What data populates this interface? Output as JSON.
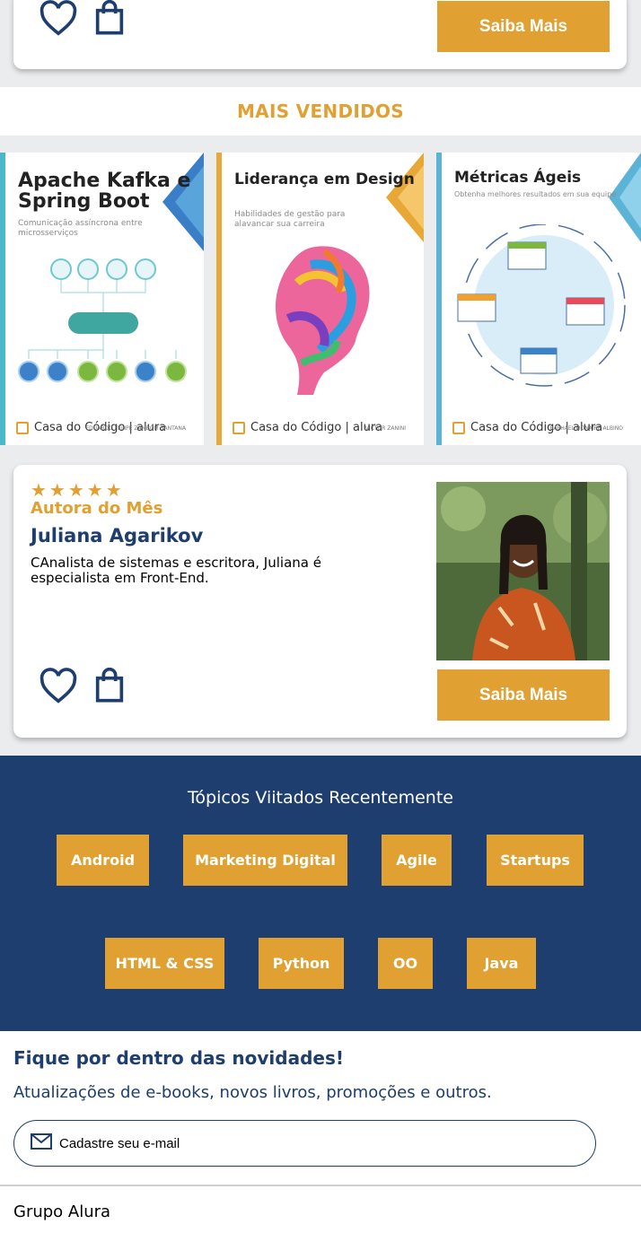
{
  "top_card": {
    "saiba_label": "Saiba Mais"
  },
  "best_sellers": {
    "title": "MAIS VENDIDOS",
    "books": [
      {
        "title": "Apache Kafka e Spring Boot",
        "subtitle": "Comunicação assíncrona entre microsserviços",
        "publisher": "Casa do Código | alura",
        "author": "EDUARDO FELIPE ZAMBOM SANTANA",
        "color": "#4bb8c8"
      },
      {
        "title": "Liderança em Design",
        "subtitle": "Habilidades de gestão para alavancar sua carreira",
        "publisher": "Casa do Código | alura",
        "author": "VICTOR ZANINI",
        "color": "#e8a93a"
      },
      {
        "title": "Métricas Ágeis",
        "subtitle": "Obtenha melhores resultados em sua equipe",
        "publisher": "Casa do Código | alura",
        "author": "RAPHAEL DONAIRE ALBINO",
        "color": "#5bb3d6"
      }
    ]
  },
  "author_card": {
    "stars": "★★★★★",
    "label": "Autora do Mês",
    "name": "Juliana Agarikov",
    "description": "CAnalista de sistemas e escritora, Juliana é especialista em Front-End.",
    "saiba_label": "Saiba Mais"
  },
  "topics": {
    "title": "Tópicos Viitados Recentemente",
    "tags": [
      "Android",
      "Marketing Digital",
      "Agile",
      "Startups",
      "HTML & CSS",
      "Python",
      "OO",
      "Java"
    ]
  },
  "newsletter": {
    "title": "Fique por dentro das novidades!",
    "subtitle": "Atualizações de e-books, novos livros, promoções e outros.",
    "email_placeholder": "Cadastre seu e-mail"
  },
  "footer": {
    "title": "Grupo Alura"
  },
  "colors": {
    "accent": "#e0a032",
    "navy": "#1d3e6e"
  }
}
